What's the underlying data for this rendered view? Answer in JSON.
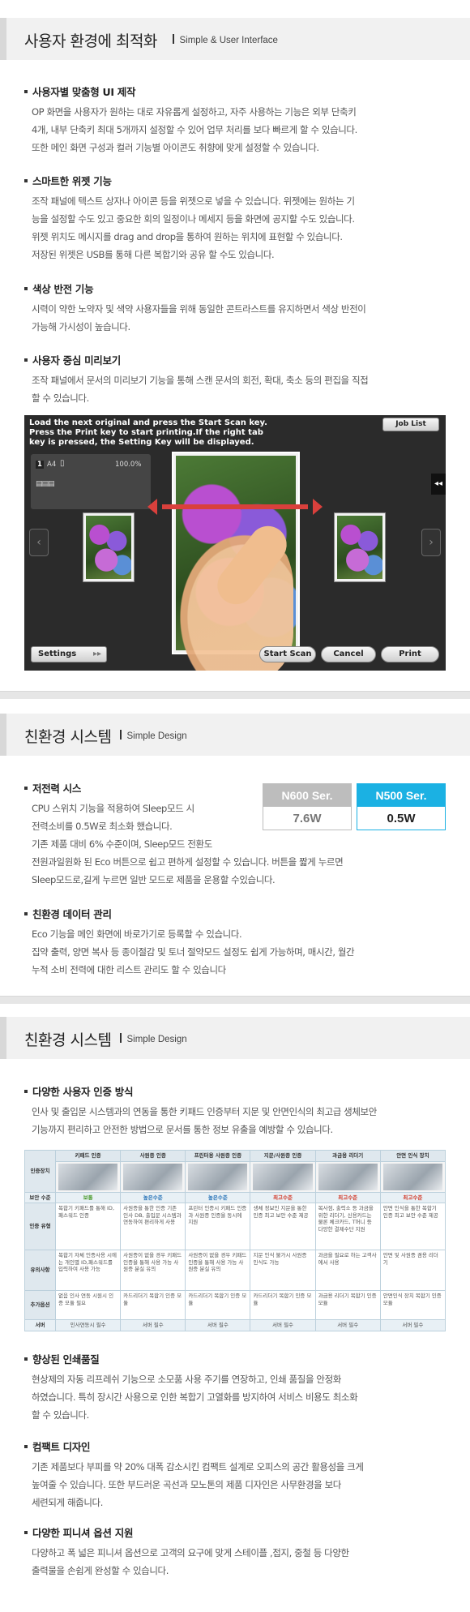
{
  "section1": {
    "title": "사용자 환경에 최적화",
    "subtitle": "Simple & User Interface",
    "items": [
      {
        "heading": "사용자별 맞춤형 UI 제작",
        "lines": [
          "OP 화면을 사용자가 원하는 대로 자유롭게 설정하고, 자주 사용하는 기능은 외부 단축키",
          "4개, 내부 단축키 최대 5개까지 설정할 수 있어 업무 처리를 보다 빠르게 할 수 있습니다.",
          "또한 메인 화면 구성과 컬러 기능별 아이콘도 취향에 맞게 설정할 수 있습니다."
        ]
      },
      {
        "heading": "스마트한 위젯 기능",
        "lines": [
          "조작 패널에 텍스트 상자나 아이콘 등을 위젯으로 넣을 수 있습니다. 위젯에는 원하는 기",
          "능을 설정할 수도 있고 중요한 회의 일정이나 메세지 등을 화면에 공지할 수도 있습니다.",
          "위젯 위치도 메시지를 drag and drop을 통하여 원하는 위치에 표현할 수 있습니다.",
          "저장된 위젯은 USB를 통해 다른 복합기와 공유 할 수도 있습니다."
        ]
      },
      {
        "heading": "색상 반전 기능",
        "lines": [
          "시력이 약한 노약자 및 색약 사용자들을 위해 동일한 콘트라스트를 유지하면서 색상 반전이",
          "가능해 가시성이 높습니다."
        ]
      },
      {
        "heading": "사용자 중심 미리보기",
        "lines": [
          "조작 패널에서 문서의 미리보기 기능을 통해 스캔 문서의 회전, 확대, 축소 등의 편집을 직접",
          "할 수 있습니다."
        ]
      }
    ]
  },
  "screen": {
    "message": "Load the next original and press the Start Scan key.\nPress the Print key to start printing.If the right tab\nkey is pressed, the Setting Key will be displayed.",
    "job_list": "Job List",
    "paper": "A4",
    "zoom": "100.0%",
    "count": "1",
    "settings": "Settings",
    "start_scan": "Start Scan",
    "cancel": "Cancel",
    "print": "Print"
  },
  "section2": {
    "title": "친환경 시스템",
    "subtitle": "Simple Design",
    "items": [
      {
        "heading": "저전력 시스",
        "lines": [
          "CPU 스위치 기능을 적용하여 Sleep모드 시",
          "전력소비를 0.5W로 최소화 했습니다.",
          "기존 제품 대비 6% 수준이며, Sleep모드 전환도",
          "전원과일원화 된 Eco 버튼으로 쉽고 편하게 설정할 수 있습니다. 버튼을 짧게 누르면",
          "Sleep모드로,길게 누르면 일반 모드로 제품을 운용할 수있습니다."
        ]
      },
      {
        "heading": "친환경 데이터 관리",
        "lines": [
          "Eco 기능을 메인 화면에 바로가기로 등록할 수 있습니다.",
          "집약 출력, 양면 복사 등 종이절감 및 토너 절약모드 설정도 쉽게 가능하며, 매시간, 월간",
          "누적 소비 전력에 대한 리스트 관리도 할 수 있습니다"
        ]
      }
    ],
    "compare": [
      {
        "name": "N600 Ser.",
        "value": "7.6W",
        "color": "#bdbdbd"
      },
      {
        "name": "N500 Ser.",
        "value": "0.5W",
        "color": "#1bb1e3"
      }
    ]
  },
  "section3": {
    "title": "친환경 시스템",
    "subtitle": "Simple Design",
    "items": [
      {
        "heading": "다양한 사용자 인증 방식",
        "lines": [
          "인사 및 출입문 시스템과의 연동을 통한 키패드 인증부터 지문 및 안면인식의 최고급 생체보안",
          "기능까지 편리하고 안전한 방법으로 문서를 통한 정보 유출을 예방할 수 있습니다."
        ]
      },
      {
        "heading": "향상된 인쇄품질",
        "lines": [
          "현상제의 자동 리프레쉬 기능으로 소모품 사용 주기를 연장하고, 인쇄 품질을 안정화",
          "하였습니다. 특히 장시간 사용으로 인한 복합기 고열화를 방지하여 서비스 비용도 최소화",
          "할 수 있습니다."
        ]
      },
      {
        "heading": "컴팩트 디자인",
        "lines": [
          "기존 제품보다 부피를 약 20% 대폭 감소시킨 컴팩트 설계로 오피스의 공간 활용성을 크게",
          "높여줄 수 있습니다. 또한 부드러운 곡선과 모노톤의 제품 디자인은 사무환경을 보다",
          "세련되게 해줍니다."
        ]
      },
      {
        "heading": "다양한 피니셔 옵션 지원",
        "lines": [
          "다양하고 폭 넓은 피니셔 옵션으로 고객의 요구에 맞게 스테이플 ,접지, 중철 등 다양한",
          "출력물을 손쉽게 완성할 수 있습니다."
        ]
      }
    ],
    "table": {
      "corner": "인증장치",
      "columns": [
        "키패드 인증",
        "사원증 인증",
        "프린터용 사원증 인증",
        "지문/사원증 인증",
        "과금용 리더기",
        "안면 인식 장치"
      ],
      "rows": [
        {
          "label": "보안 수준",
          "cells": [
            "보통",
            "높은수준",
            "높은수준",
            "최고수준",
            "최고수준",
            "최고수준"
          ]
        },
        {
          "label": "인증 유형",
          "cells": [
            "복합기 키패드를 통해 ID, 패스워드 인증",
            "사원증을 통한 인증 기존 인사 DB, 출입문 시스템과 연동하여 편리하게 사용",
            "프린터 인증시 키패드 인증과 사원증 인증을 동시에 지원",
            "생체 정보인 지문을 통한 인증 최고 보안 수준 제공",
            "복사점, 출력소 등 과금을 위한 리더기, 신용카드는 물론 체크카드, T머니 등 다양한 결제수단 지원",
            "안면 인식을 통한 복합기 인증 최고 보안 수준 제공"
          ]
        },
        {
          "label": "유의사항",
          "cells": [
            "복합기 자체 인증사용 시에는 개인별 ID,패스워드를 입력하여 사용 가능",
            "사원증이 없을 경우 키패드 인증을 통해 사용 가능 사원증 분실 유의",
            "사원증이 없을 경우 키패드 인증을 통해 사용 가능 사원증 분실 유의",
            "지문 인식 불가시 사원증 인식도 가능",
            "과금을 필요로 하는 고객사에서 사용",
            "안면 및 사원증 겸용 리더기"
          ]
        },
        {
          "label": "추가옵션",
          "cells": [
            "없음 인사 연동 시원시 인증 모듈 필요",
            "카드리더기 복합기 인증 모듈",
            "카드리더기 복합기 인증 모듈",
            "카드리더기 복합기 인증 모듈",
            "과금용 리더기 복합기 인증 모듈",
            "안면인식 장치 복합기 인증 모듈"
          ]
        },
        {
          "label": "서버",
          "cells": [
            "인사연동시 필수",
            "서버 필수",
            "서버 필수",
            "서버 필수",
            "서버 필수",
            "서버 필수"
          ]
        }
      ]
    }
  }
}
